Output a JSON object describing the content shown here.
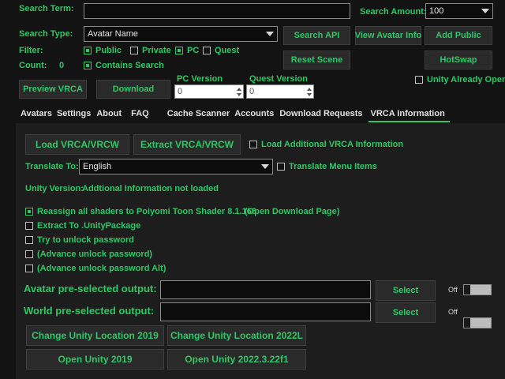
{
  "search": {
    "term_label": "Search Term:",
    "term_value": "",
    "amount_label": "Search Amount:",
    "amount_value": "100",
    "type_label": "Search Type:",
    "type_value": "Avatar Name",
    "filter_label": "Filter:",
    "filter_public": "Public",
    "filter_private": "Private",
    "filter_pc": "PC",
    "filter_quest": "Quest",
    "count_label": "Count:",
    "count_value": "0",
    "contains_search": "Contains Search"
  },
  "buttons": {
    "search_api": "Search API",
    "view_avatar_info": "View Avatar Info",
    "add_public": "Add Public",
    "reset_scene": "Reset Scene",
    "hotswap": "HotSwap",
    "preview_vrca": "Preview VRCA",
    "download": "Download"
  },
  "versions": {
    "pc_label": "PC Version",
    "pc_value": "0",
    "quest_label": "Quest Version",
    "quest_value": "0",
    "unity_open": "Unity Already Open"
  },
  "tabs": [
    {
      "label": "Avatars"
    },
    {
      "label": "Settings"
    },
    {
      "label": "About"
    },
    {
      "label": "FAQ"
    },
    {
      "label": "Cache Scanner"
    },
    {
      "label": "Accounts"
    },
    {
      "label": "Download Requests"
    },
    {
      "label": "VRCA Information"
    }
  ],
  "vrca": {
    "load_button": "Load VRCA/VRCW",
    "extract_button": "Extract VRCA/VRCW",
    "load_additional": "Load Additional VRCA Information",
    "translate_label": "Translate To:",
    "translate_value": "English",
    "translate_menu": "Translate Menu Items",
    "unity_version_label": "Unity Version:",
    "unity_version_value": "Addtional Information not loaded",
    "reassign_shaders": "Reassign all shaders to Poiyomi Toon Shader 8.1.166",
    "open_download_page": "(Open Download Page)",
    "extract_unitypackage": "Extract To .UnityPackage",
    "try_unlock": "Try to unlock password",
    "advance_unlock": "(Advance unlock password)",
    "advance_unlock_alt": "(Advance unlock password Alt)",
    "avatar_output_label": "Avatar pre-selected output:",
    "avatar_output_value": "",
    "world_output_label": "World pre-selected output:",
    "world_output_value": "",
    "select_label": "Select",
    "off_label": "Off",
    "change_unity_2019": "Change Unity Location 2019",
    "change_unity_2022": "Change Unity Location 2022L",
    "open_unity_2019": "Open Unity 2019",
    "open_unity_2022": "Open Unity 2022.3.22f1"
  },
  "colors": {
    "accent": "#2ec866",
    "background": "#131313",
    "panel": "#1d1d1d"
  },
  "icons": [
    "dropdown-arrow-icon",
    "spinner-up-icon",
    "spinner-down-icon",
    "checkbox-icon",
    "toggle-switch-icon"
  ]
}
